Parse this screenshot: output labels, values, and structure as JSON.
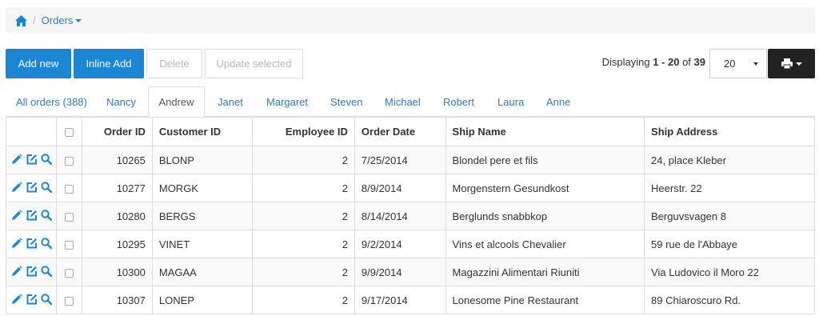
{
  "breadcrumb": {
    "current": "Orders"
  },
  "toolbar": {
    "add_new": "Add new",
    "inline_add": "Inline Add",
    "delete": "Delete",
    "update_selected": "Update selected",
    "paging_prefix": "Displaying ",
    "paging_range": "1 - 20",
    "paging_of": " of ",
    "paging_total": "39",
    "page_size": "20"
  },
  "tabs": [
    "All orders (388)",
    "Nancy",
    "Andrew",
    "Janet",
    "Margaret",
    "Steven",
    "Michael",
    "Robert",
    "Laura",
    "Anne"
  ],
  "active_tab": "Andrew",
  "table": {
    "headers": [
      "Order ID",
      "Customer ID",
      "Employee ID",
      "Order Date",
      "Ship Name",
      "Ship Address"
    ],
    "rows": [
      [
        "10265",
        "BLONP",
        "2",
        "7/25/2014",
        "Blondel pere et fils",
        "24, place Kleber"
      ],
      [
        "10277",
        "MORGK",
        "2",
        "8/9/2014",
        "Morgenstern Gesundkost",
        "Heerstr. 22"
      ],
      [
        "10280",
        "BERGS",
        "2",
        "8/14/2014",
        "Berglunds snabbkop",
        "Berguvsvagen 8"
      ],
      [
        "10295",
        "VINET",
        "2",
        "9/2/2014",
        "Vins et alcools Chevalier",
        "59 rue de l'Abbaye"
      ],
      [
        "10300",
        "MAGAA",
        "2",
        "9/9/2014",
        "Magazzini Alimentari Riuniti",
        "Via Ludovico il Moro 22"
      ],
      [
        "10307",
        "LONEP",
        "2",
        "9/17/2014",
        "Lonesome Pine Restaurant",
        "89 Chiaroscuro Rd."
      ]
    ]
  },
  "colors": {
    "primary": "#1b86d4",
    "link": "#337ab7",
    "print_bg": "#222222",
    "icon": "#1b86d4"
  },
  "icons": [
    "home-icon",
    "pencil-icon",
    "edit-icon",
    "search-icon",
    "print-icon"
  ]
}
